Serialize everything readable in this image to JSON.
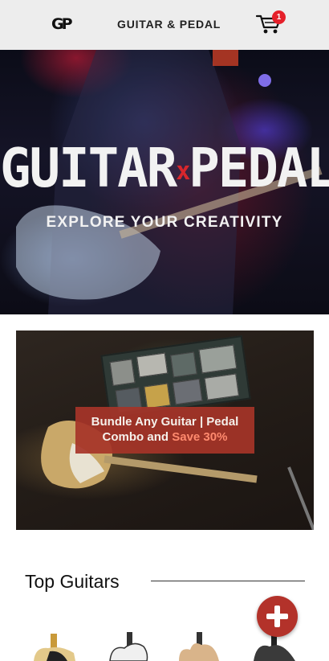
{
  "header": {
    "logo": "GP",
    "brand": "GUITAR & PEDAL",
    "cart_count": "1",
    "badge_color": "#e5202a"
  },
  "hero": {
    "title_left": "GUITAR",
    "title_x": "x",
    "title_right": "PEDAL",
    "subtitle": "EXPLORE YOUR CREATIVITY"
  },
  "promo": {
    "line1": "Bundle Any Guitar | Pedal",
    "line2_prefix": "Combo and ",
    "line2_highlight": "Save 30%"
  },
  "section": {
    "title": "Top Guitars"
  },
  "fab": {
    "icon": "plus-icon",
    "color": "#b3322a"
  },
  "guitars": [
    {
      "name": "guitar-thumb-1"
    },
    {
      "name": "guitar-thumb-2"
    },
    {
      "name": "guitar-thumb-3"
    },
    {
      "name": "guitar-thumb-4"
    }
  ]
}
